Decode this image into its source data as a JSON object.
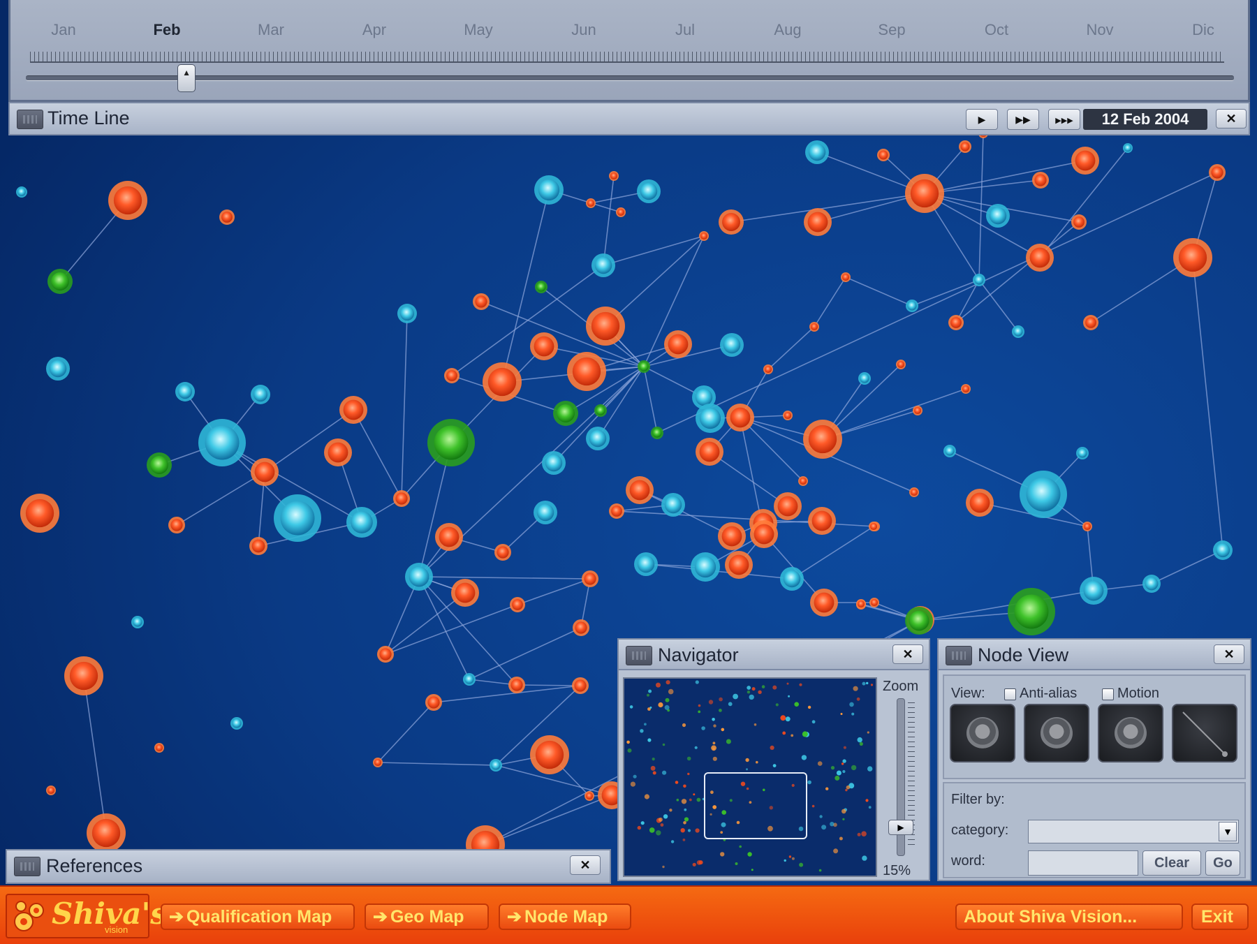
{
  "colors": {
    "accent_orange": "#f0561a",
    "node_red": "#f24a1c",
    "node_green": "#3bbf2a",
    "node_cyan": "#3ec9e6",
    "background": "#0a3a85"
  },
  "timeline": {
    "title": "Time Line",
    "months": [
      "Jan",
      "Feb",
      "Mar",
      "Apr",
      "May",
      "Jun",
      "Jul",
      "Aug",
      "Sep",
      "Oct",
      "Nov",
      "Dic"
    ],
    "selected_month": "Feb",
    "date": "12 Feb 2004",
    "slider_fraction": 0.133,
    "controls": [
      "play-icon",
      "fast-forward-icon",
      "skip-forward-icon"
    ]
  },
  "references": {
    "title": "References"
  },
  "navigator": {
    "title": "Navigator",
    "zoom_label": "Zoom",
    "zoom_value": "15%",
    "zoom_fraction": 0.15
  },
  "node_view": {
    "title": "Node View",
    "view_label": "View:",
    "antialias_label": "Anti-alias",
    "motion_label": "Motion",
    "filter_label": "Filter by:",
    "category_label": "category:",
    "category_value": "",
    "word_label": "word:",
    "word_value": "",
    "clear_label": "Clear",
    "go_label": "Go"
  },
  "bottom": {
    "logo_text": "Shiva's",
    "logo_sub": "vision",
    "nav": [
      "Qualification Map",
      "Geo Map",
      "Node Map"
    ],
    "about_label": "About Shiva Vision...",
    "exit_label": "Exit"
  }
}
